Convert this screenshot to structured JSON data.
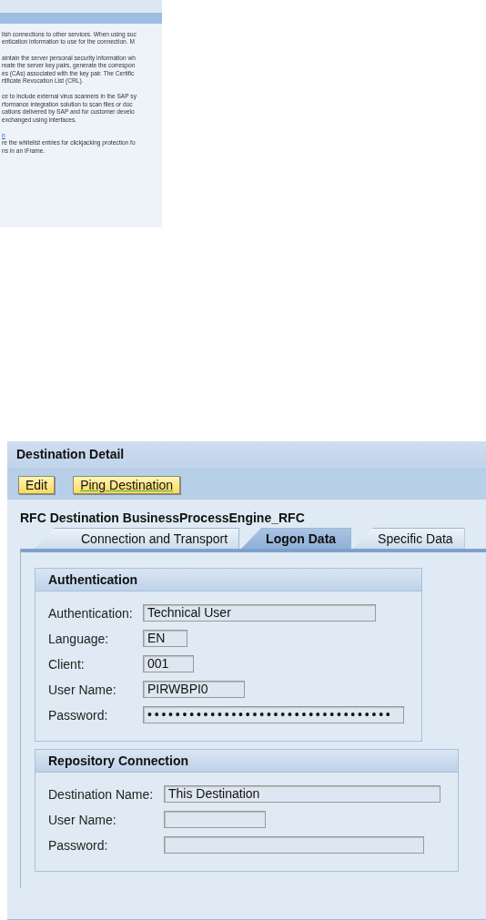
{
  "upper_panel": {
    "paragraphs": [
      {
        "lines": [
          {
            "text": "lish connections to other services. When using suc"
          },
          {
            "text": "entication information to use for the connection. M"
          }
        ]
      },
      {
        "lines": [
          {
            "text": "aintain the server personal security information wh"
          },
          {
            "text": "reate the server key pairs, generate the correspon"
          },
          {
            "text": "es (CAs) associated with the key pair. The Certific"
          },
          {
            "text": "rtificate Revocation List (CRL)."
          }
        ]
      },
      {
        "lines": [
          {
            "text": "ce to include external virus scanners in the SAP sy"
          },
          {
            "text": "rformance integration solution to scan files or doc"
          },
          {
            "text": "cations delivered by SAP and for customer develo"
          },
          {
            "text": "exchanged using interfaces."
          }
        ]
      },
      {
        "lines": [
          {
            "text": "n",
            "kind": "link"
          },
          {
            "text": "re the whitelist entries for clickjacking protection fo"
          },
          {
            "text": "ns in an iFrame."
          }
        ]
      }
    ]
  },
  "destination_detail": {
    "title": "Destination Detail",
    "buttons": [
      "Edit",
      "Ping Destination"
    ],
    "heading": "RFC Destination BusinessProcessEngine_RFC",
    "tabs": [
      {
        "label": "Connection and Transport",
        "selected": false
      },
      {
        "label": "Logon Data",
        "selected": true
      },
      {
        "label": "Specific Data",
        "selected": false
      }
    ],
    "groups": [
      {
        "title": "Authentication",
        "fields": [
          {
            "label": "Authentication:",
            "value": "Technical User"
          },
          {
            "label": "Language:",
            "value": "EN"
          },
          {
            "label": "Client:",
            "value": "001"
          },
          {
            "label": "User Name:",
            "value": "PIRWBPI0"
          },
          {
            "label": "Password:",
            "value": "•••••••••••••••••••••••••••••••••••"
          }
        ]
      },
      {
        "title": "Repository Connection",
        "fields": [
          {
            "label": "Destination Name:",
            "value": "This Destination"
          },
          {
            "label": "User Name:"
          },
          {
            "label": "Password:"
          }
        ]
      }
    ]
  }
}
